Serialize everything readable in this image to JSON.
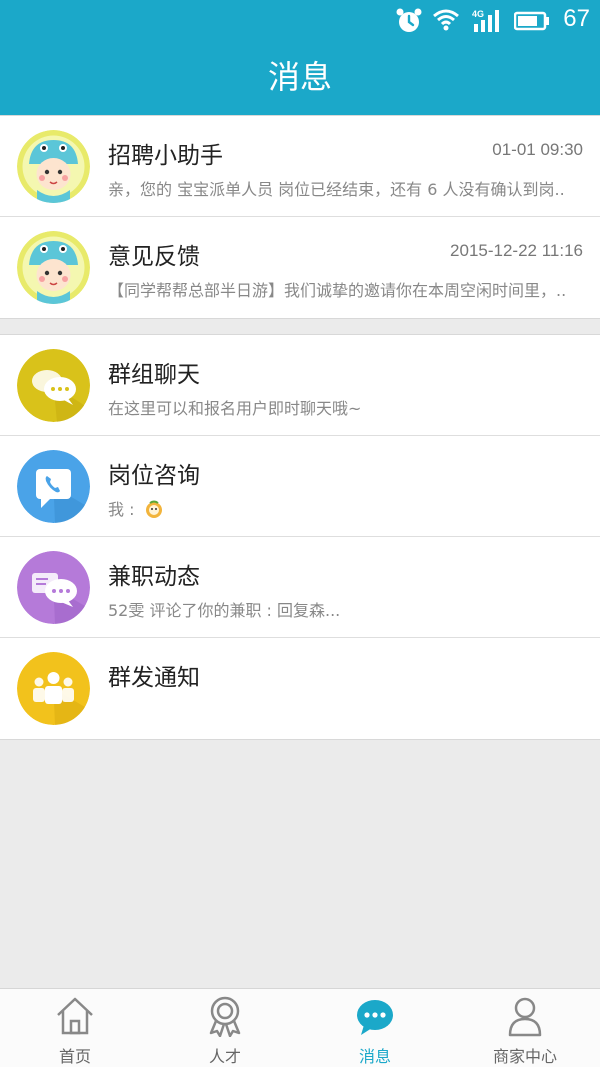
{
  "status_bar": {
    "battery_level": "67",
    "network": "4G",
    "icons": [
      "alarm-icon",
      "wifi-icon",
      "signal-icon",
      "battery-icon"
    ]
  },
  "header": {
    "title": "消息"
  },
  "messages": [
    {
      "title": "招聘小助手",
      "time": "01-01 09:30",
      "preview": "亲，您的 宝宝派单人员 岗位已经结束，还有 6 人没有确认到岗..",
      "avatar": "baby-avatar"
    },
    {
      "title": "意见反馈",
      "time": "2015-12-22 11:16",
      "preview": "【同学帮帮总部半日游】我们诚挚的邀请你在本周空闲时间里，..",
      "avatar": "baby-avatar"
    }
  ],
  "channels": [
    {
      "title": "群组聊天",
      "preview": "在这里可以和报名用户即时聊天哦~",
      "icon": "chat-bubbles-icon",
      "color": "#d9c21a"
    },
    {
      "title": "岗位咨询",
      "preview": "我 :",
      "icon": "phone-chat-icon",
      "color": "#4aa3e8"
    },
    {
      "title": "兼职动态",
      "preview": "52雯 评论了你的兼职 : 回复森...",
      "icon": "comments-icon",
      "color": "#b57ad9"
    },
    {
      "title": "群发通知",
      "preview": "",
      "icon": "group-users-icon",
      "color": "#f2c21c"
    }
  ],
  "tabbar": {
    "tabs": [
      {
        "label": "首页",
        "icon": "home-icon",
        "active": false
      },
      {
        "label": "人才",
        "icon": "badge-icon",
        "active": false
      },
      {
        "label": "消息",
        "icon": "message-icon",
        "active": true
      },
      {
        "label": "商家中心",
        "icon": "user-icon",
        "active": false
      }
    ]
  },
  "colors": {
    "primary": "#1ba8c9",
    "background": "#ebebeb"
  }
}
